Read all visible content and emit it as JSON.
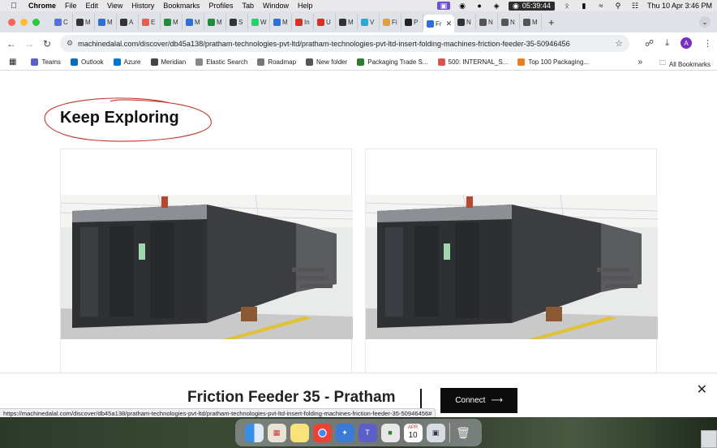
{
  "menubar": {
    "app": "Chrome",
    "items": [
      "File",
      "Edit",
      "View",
      "History",
      "Bookmarks",
      "Profiles",
      "Tab",
      "Window",
      "Help"
    ],
    "timer": "05:39:44",
    "clock": "Thu 10 Apr  3:46 PM"
  },
  "tabs": [
    {
      "label": "C",
      "color": "#5b6ee1"
    },
    {
      "label": "M",
      "color": "#333333"
    },
    {
      "label": "M",
      "color": "#2d6fd6"
    },
    {
      "label": "A",
      "color": "#333333"
    },
    {
      "label": "E",
      "color": "#e65d4c"
    },
    {
      "label": "M",
      "color": "#1e8e3e"
    },
    {
      "label": "M",
      "color": "#2d6fd6"
    },
    {
      "label": "M",
      "color": "#1e8e3e"
    },
    {
      "label": "S",
      "color": "#333333"
    },
    {
      "label": "W",
      "color": "#25d366"
    },
    {
      "label": "M",
      "color": "#2d6fd6"
    },
    {
      "label": "In",
      "color": "#d93025"
    },
    {
      "label": "U",
      "color": "#d93025"
    },
    {
      "label": "M",
      "color": "#333333"
    },
    {
      "label": "V",
      "color": "#2aa8d8"
    },
    {
      "label": "Fi",
      "color": "#e0a040"
    },
    {
      "label": "P",
      "color": "#222222"
    },
    {
      "label": "Fr",
      "color": "#2f6edc",
      "active": true
    },
    {
      "label": "N",
      "color": "#333333"
    },
    {
      "label": "N",
      "color": "#555555"
    },
    {
      "label": "N",
      "color": "#555555"
    },
    {
      "label": "M",
      "color": "#555555"
    }
  ],
  "toolbar": {
    "url": "machinedalal.com/discover/db45a138/pratham-technologies-pvt-ltd/pratham-technologies-pvt-ltd-insert-folding-machines-friction-feeder-35-50946456",
    "profile_initial": "A"
  },
  "bookmarks": [
    {
      "label": "Teams",
      "color": "#5b5fc7"
    },
    {
      "label": "Outlook",
      "color": "#0f6cbd"
    },
    {
      "label": "Azure",
      "color": "#0078d4"
    },
    {
      "label": "Meridian",
      "color": "#444444"
    },
    {
      "label": "Elastic Search",
      "color": "#888888"
    },
    {
      "label": "Roadmap",
      "color": "#777777"
    },
    {
      "label": "New folder",
      "color": "#555555"
    },
    {
      "label": "Packaging Trade S...",
      "color": "#2e7d32"
    },
    {
      "label": "500: INTERNAL_S...",
      "color": "#d9534f"
    },
    {
      "label": "Top 100 Packaging...",
      "color": "#e67e22"
    }
  ],
  "bookmarks_all": "All Bookmarks",
  "page": {
    "section_title": "Keep Exploring"
  },
  "sticky": {
    "product_title": "Friction Feeder 35 - Pratham",
    "connect_label": "Connect"
  },
  "status_url": "https://machinedalal.com/discover/db45a138/pratham-technologies-pvt-ltd/pratham-technologies-pvt-ltd-insert-folding-machines-friction-feeder-35-50946456#",
  "dock": {
    "calendar_month": "APR",
    "calendar_day": "10"
  }
}
